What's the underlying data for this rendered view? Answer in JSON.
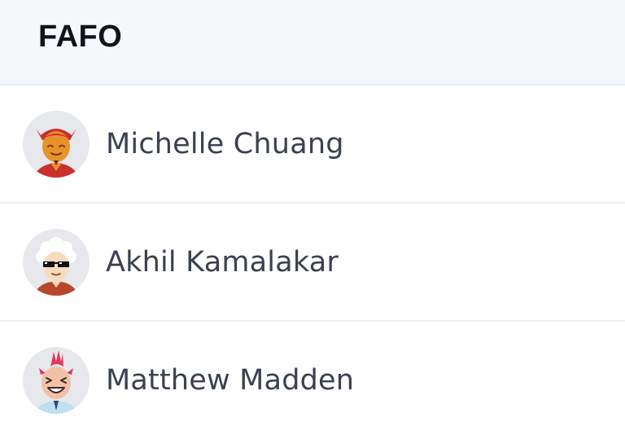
{
  "header": {
    "title": "FAFO"
  },
  "members": [
    {
      "name": "Michelle Chuang",
      "avatar_icon": "devil-avatar-icon"
    },
    {
      "name": "Akhil Kamalakar",
      "avatar_icon": "sunglasses-avatar-icon"
    },
    {
      "name": "Matthew Madden",
      "avatar_icon": "mohawk-avatar-icon"
    }
  ],
  "colors": {
    "header_bg": "#f5f8fb",
    "text_primary": "#111418",
    "text_name": "#3a4150",
    "divider": "#eceff2",
    "avatar_bg": "#e6e8ec"
  }
}
